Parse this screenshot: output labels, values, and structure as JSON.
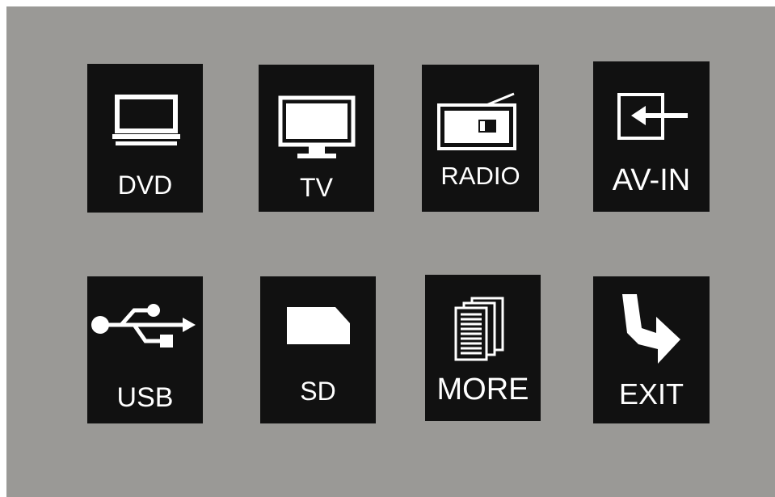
{
  "menu": {
    "items": [
      {
        "id": "dvd",
        "label": "DVD",
        "icon": "dvd-player-icon"
      },
      {
        "id": "tv",
        "label": "TV",
        "icon": "tv-icon"
      },
      {
        "id": "radio",
        "label": "RADIO",
        "icon": "radio-icon"
      },
      {
        "id": "avin",
        "label": "AV-IN",
        "icon": "av-input-icon"
      },
      {
        "id": "usb",
        "label": "USB",
        "icon": "usb-icon"
      },
      {
        "id": "sd",
        "label": "SD",
        "icon": "sd-card-icon"
      },
      {
        "id": "more",
        "label": "MORE",
        "icon": "documents-icon"
      },
      {
        "id": "exit",
        "label": "EXIT",
        "icon": "exit-arrow-icon"
      }
    ]
  },
  "colors": {
    "background": "#9a9996",
    "tile": "#111111",
    "foreground": "#ffffff"
  }
}
